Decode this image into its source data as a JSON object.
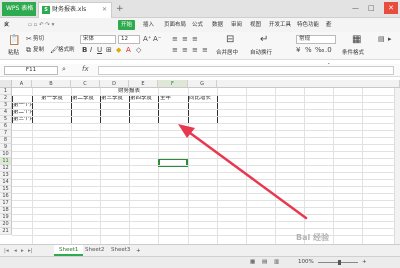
{
  "titlebar": {
    "app_tab": "WPS 表格",
    "doc_tab": "财务报表.xls",
    "new_tab": "+",
    "minimize": "—",
    "restore": "□",
    "close": "✕"
  },
  "menu": {
    "file": "文件",
    "items": [
      "开始",
      "插入",
      "页面布局",
      "公式",
      "数据",
      "审阅",
      "视图",
      "开发工具",
      "特色功能"
    ],
    "active": "开始",
    "search": "查找命令"
  },
  "toolbar": {
    "paste": "粘贴",
    "cut": "剪切",
    "copy": "复制",
    "format_painter": "格式刷",
    "font_name": "宋体",
    "font_size": "12",
    "merge_center": "合并居中",
    "auto_wrap": "自动换行",
    "number_format": "常规",
    "conditional_format": "条件格式"
  },
  "formula_bar": {
    "name_box": "F11",
    "fx": "fx",
    "value": ""
  },
  "sheet": {
    "columns": [
      "A",
      "B",
      "C",
      "D",
      "E",
      "F",
      "G"
    ],
    "selected_column": "F",
    "rows": [
      "1",
      "2",
      "3",
      "4",
      "5",
      "6",
      "7",
      "8",
      "9",
      "10",
      "11",
      "12",
      "13",
      "14",
      "15",
      "16",
      "17",
      "18",
      "19",
      "20",
      "21"
    ],
    "selected_row": "11",
    "title": "财务报表",
    "headers": [
      "第一季度",
      "第二季度",
      "第三季度",
      "第四季度",
      "全年",
      "同比增长"
    ],
    "row_labels": [
      "第一个月",
      "第二个月",
      "第三个月"
    ]
  },
  "sheets": {
    "tabs": [
      "Sheet1",
      "Sheet2",
      "Sheet3"
    ],
    "active": "Sheet1",
    "add": "+"
  },
  "status": {
    "zoom": "100%"
  },
  "annotation": {
    "color": "#e8384f"
  },
  "watermark": "Bai 经验"
}
